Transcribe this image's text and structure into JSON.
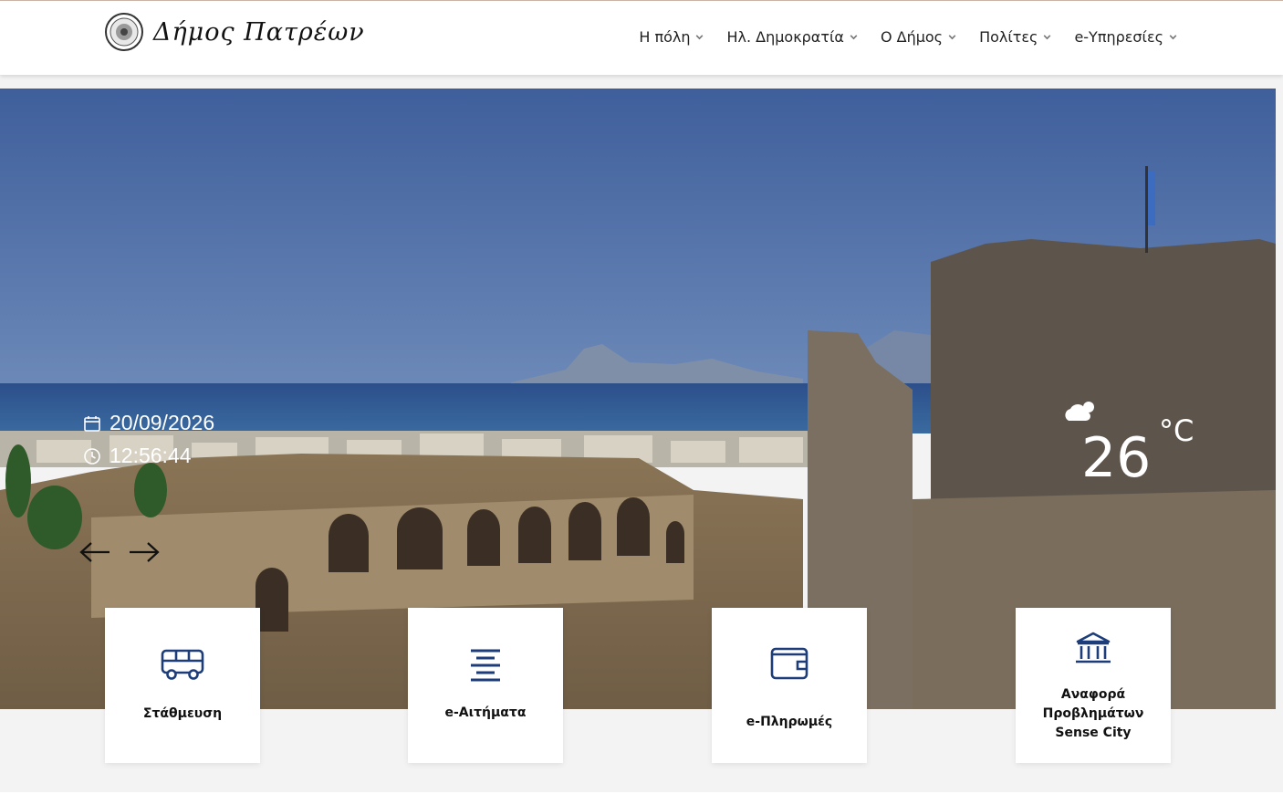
{
  "header": {
    "logo_text": "Δήμος Πατρέων",
    "nav": [
      {
        "label": "Η πόλη"
      },
      {
        "label": "Ηλ. Δημοκρατία"
      },
      {
        "label": "Ο Δήμος"
      },
      {
        "label": "Πολίτες"
      },
      {
        "label": "e-Υπηρεσίες"
      }
    ]
  },
  "hero": {
    "date": "20/09/2026",
    "time": "12:56:44",
    "weather": {
      "temperature": "26",
      "unit": "°C",
      "icon": "partly-cloudy-icon"
    }
  },
  "cards": [
    {
      "label": "Στάθμευση",
      "icon": "bus-icon"
    },
    {
      "label": "e-Αιτήματα",
      "icon": "align-center-icon"
    },
    {
      "label": "e-Πληρωμές",
      "icon": "wallet-icon"
    },
    {
      "label_lines": [
        "Αναφορά",
        "Προβλημάτων",
        "Sense City"
      ],
      "icon": "institution-icon"
    }
  ],
  "colors": {
    "accent": "#1d3d7a",
    "header_bg": "#ffffff",
    "page_bg": "#f3f3f3"
  }
}
